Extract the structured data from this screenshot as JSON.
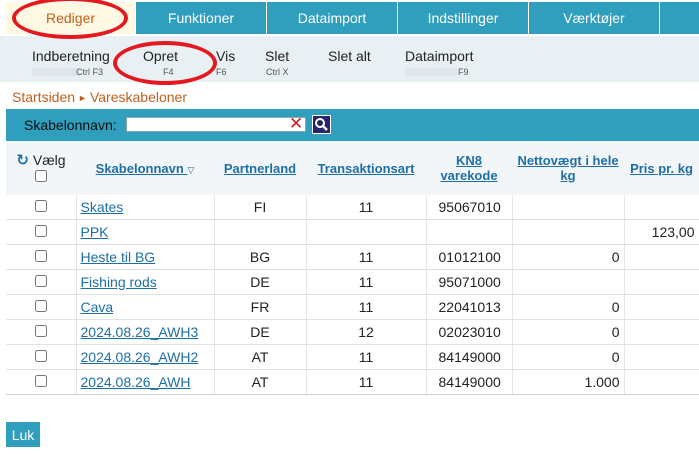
{
  "tabs": [
    {
      "label": "Rediger"
    },
    {
      "label": "Funktioner"
    },
    {
      "label": "Dataimport"
    },
    {
      "label": "Indstillinger"
    },
    {
      "label": "Værktøjer"
    }
  ],
  "toolbar": {
    "items": [
      {
        "label": "Indberetning",
        "shortcut": "Ctrl F3"
      },
      {
        "label": "Opret",
        "shortcut": "F4"
      },
      {
        "label": "Vis",
        "shortcut": "F6"
      },
      {
        "label": "Slet",
        "shortcut": "Ctrl X"
      },
      {
        "label": "Slet alt",
        "shortcut": ""
      },
      {
        "label": "Dataimport",
        "shortcut": "F9"
      }
    ]
  },
  "breadcrumb": {
    "home": "Startsiden",
    "current": "Vareskabeloner"
  },
  "search": {
    "label": "Skabelonnavn:",
    "value": "",
    "placeholder": "",
    "clear_icon": "close-x-icon",
    "search_icon": "magnifier-icon"
  },
  "table": {
    "columns": {
      "select": "Vælg",
      "name": "Skabelonnavn",
      "country": "Partnerland",
      "transaction": "Transaktionsart",
      "kn8": "KN8 varekode",
      "netweight": "Nettovægt i hele kg",
      "price": "Pris pr. kg"
    },
    "rows": [
      {
        "name": "Skates",
        "country": "FI",
        "transaction": "11",
        "kn8": "95067010",
        "netweight": "",
        "price": ""
      },
      {
        "name": "PPK",
        "country": "",
        "transaction": "",
        "kn8": "",
        "netweight": "",
        "price": "123,00"
      },
      {
        "name": "Heste til BG",
        "country": "BG",
        "transaction": "11",
        "kn8": "01012100",
        "netweight": "0",
        "price": ""
      },
      {
        "name": "Fishing rods",
        "country": "DE",
        "transaction": "11",
        "kn8": "95071000",
        "netweight": "",
        "price": ""
      },
      {
        "name": "Cava",
        "country": "FR",
        "transaction": "11",
        "kn8": "22041013",
        "netweight": "0",
        "price": ""
      },
      {
        "name": "2024.08.26_AWH3",
        "country": "DE",
        "transaction": "12",
        "kn8": "02023010",
        "netweight": "0",
        "price": ""
      },
      {
        "name": "2024.08.26_AWH2",
        "country": "AT",
        "transaction": "11",
        "kn8": "84149000",
        "netweight": "0",
        "price": ""
      },
      {
        "name": "2024.08.26_AWH",
        "country": "AT",
        "transaction": "11",
        "kn8": "84149000",
        "netweight": "1.000",
        "price": ""
      }
    ]
  },
  "footer": {
    "close_label": "Luk"
  },
  "colors": {
    "accent": "#2f9fbd",
    "active_tab_text": "#c0601f",
    "link": "#1d6fa5",
    "annotation_ring": "#e3191f"
  }
}
